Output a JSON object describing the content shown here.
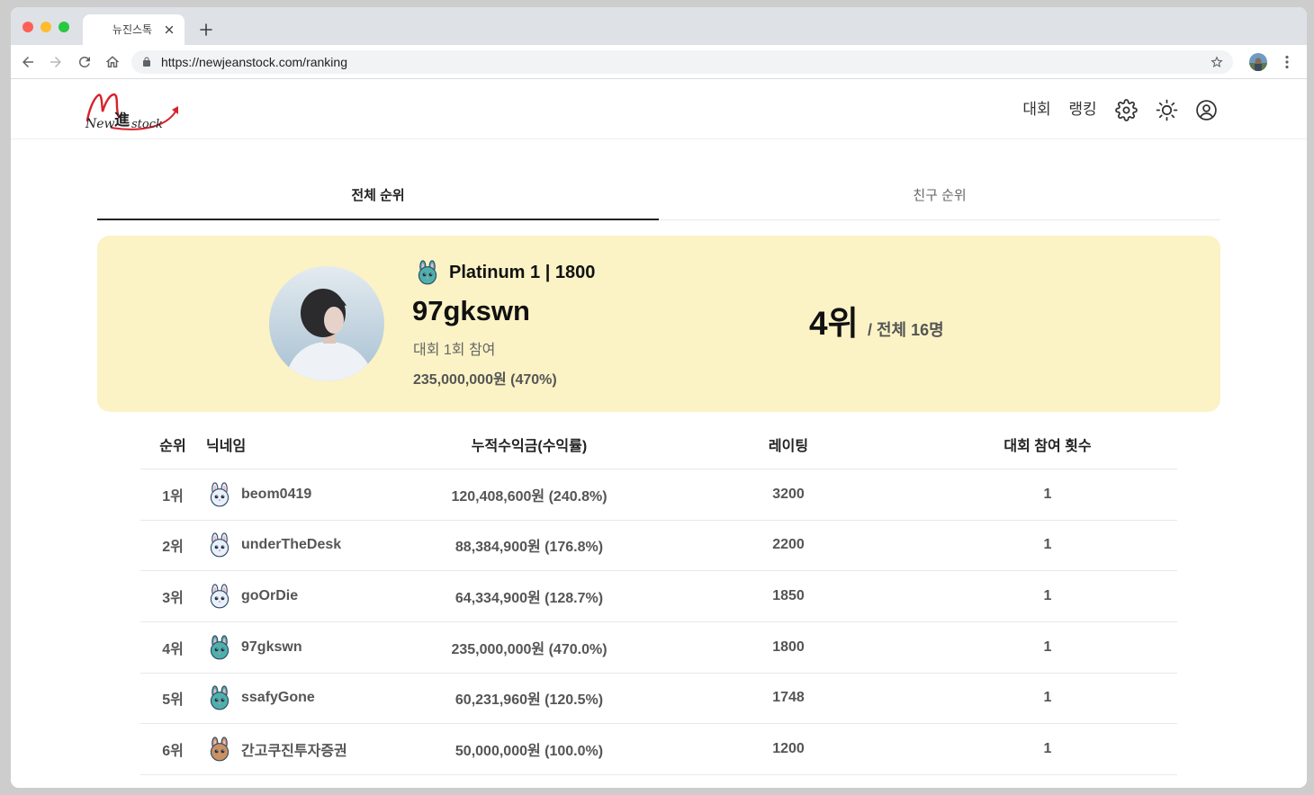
{
  "browser": {
    "tab_title": "뉴진스톡",
    "url": "https://newjeanstock.com/ranking",
    "traffic_lights": [
      "#ff5f57",
      "#febc2e",
      "#28c840"
    ]
  },
  "header": {
    "logo": {
      "new": "New",
      "mid": "進",
      "stock": "stock",
      "accent_color": "#d7212c"
    },
    "nav": [
      {
        "label": "대회"
      },
      {
        "label": "랭킹"
      }
    ],
    "icon_names": [
      "gear-icon",
      "sun-icon",
      "user-circle-icon"
    ]
  },
  "tabs": [
    {
      "label": "전체 순위",
      "active": true
    },
    {
      "label": "친구 순위",
      "active": false
    }
  ],
  "my_rank": {
    "tier_icon": "bunny-icon",
    "tier_color": "#4fb0ab",
    "tier_label": "Platinum 1 | 1800",
    "nickname": "97gkswn",
    "participation": "대회 1회 참여",
    "profit": "235,000,000원 (470%)",
    "rank": "4위",
    "total": "/ 전체 16명",
    "background": "#fbf3c5"
  },
  "table": {
    "headers": {
      "rank": "순위",
      "nickname": "닉네임",
      "profit": "누적수익금(수익률)",
      "rating": "레이팅",
      "count": "대회 참여 횟수"
    },
    "rows": [
      {
        "rank": "1위",
        "nickname": "beom0419",
        "profit": "120,408,600원 (240.8%)",
        "rating": "3200",
        "count": "1",
        "tier_color": "#e8f0fb"
      },
      {
        "rank": "2위",
        "nickname": "underTheDesk",
        "profit": "88,384,900원 (176.8%)",
        "rating": "2200",
        "count": "1",
        "tier_color": "#e8f0fb"
      },
      {
        "rank": "3위",
        "nickname": "goOrDie",
        "profit": "64,334,900원 (128.7%)",
        "rating": "1850",
        "count": "1",
        "tier_color": "#e8f0fb"
      },
      {
        "rank": "4위",
        "nickname": "97gkswn",
        "profit": "235,000,000원 (470.0%)",
        "rating": "1800",
        "count": "1",
        "tier_color": "#4fb0ab"
      },
      {
        "rank": "5위",
        "nickname": "ssafyGone",
        "profit": "60,231,960원 (120.5%)",
        "rating": "1748",
        "count": "1",
        "tier_color": "#4fb0ab"
      },
      {
        "rank": "6위",
        "nickname": "간고쿠진투자증권",
        "profit": "50,000,000원 (100.0%)",
        "rating": "1200",
        "count": "1",
        "tier_color": "#c99161"
      }
    ]
  }
}
